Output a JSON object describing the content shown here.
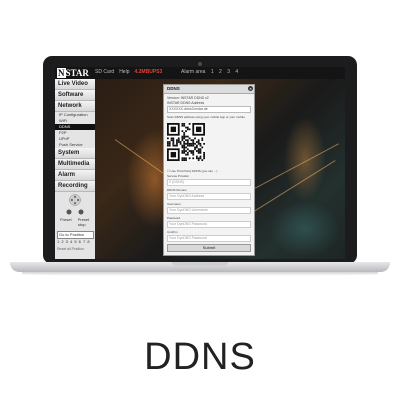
{
  "caption": "DDNS",
  "app": {
    "logo_prefix": "N",
    "logo_rest": "STAR",
    "topnav": [
      "SD Card",
      "Help",
      "4.2MBUPS3",
      "Alarm area",
      "1",
      "2",
      "3",
      "4"
    ],
    "topnav_red_index": 2
  },
  "sidebar": {
    "sections": [
      {
        "label": "Live Video"
      },
      {
        "label": "Software"
      },
      {
        "label": "Network",
        "items": [
          "IP Configuration",
          "WiFi",
          "DDNS",
          "P2P",
          "UPnP",
          "Push Service"
        ],
        "active_item": "DDNS"
      },
      {
        "label": "System"
      },
      {
        "label": "Multimedia"
      },
      {
        "label": "Alarm"
      },
      {
        "label": "Recording"
      }
    ],
    "ptz_labels": [
      "Preset",
      "Preset"
    ],
    "ptz_sublabels": [
      "",
      "stop"
    ],
    "goto_label": "Go to Position",
    "presets": "1 2 3 4 5 6 7 8",
    "reset_all": "Reset all Position"
  },
  "dialog": {
    "title": "DDNS",
    "close_icon": "close-icon",
    "fields_top": [
      {
        "label": "Version: INSTAR DDNS v2",
        "value": ""
      },
      {
        "label": "INSTAR DDNS Address",
        "value": "XXXXXX.ddns3.instar.de"
      }
    ],
    "qr_caption": "Scan DDNS address using your mobile App or your mobile",
    "third_party_label": "Use Third Party DDNS (you can ...)",
    "fields_bottom": [
      {
        "label": "Service Provider",
        "value": "3 (DDNS)"
      },
      {
        "label": "DDNS Domain",
        "value": "Your DynDNS Address"
      },
      {
        "label": "Username",
        "value": "Your DynDNS Username"
      },
      {
        "label": "Password",
        "value": "Your DynDNS Password"
      },
      {
        "label": "Confirm",
        "value": "Your DynDNS Password"
      }
    ],
    "submit_label": "Submit"
  }
}
